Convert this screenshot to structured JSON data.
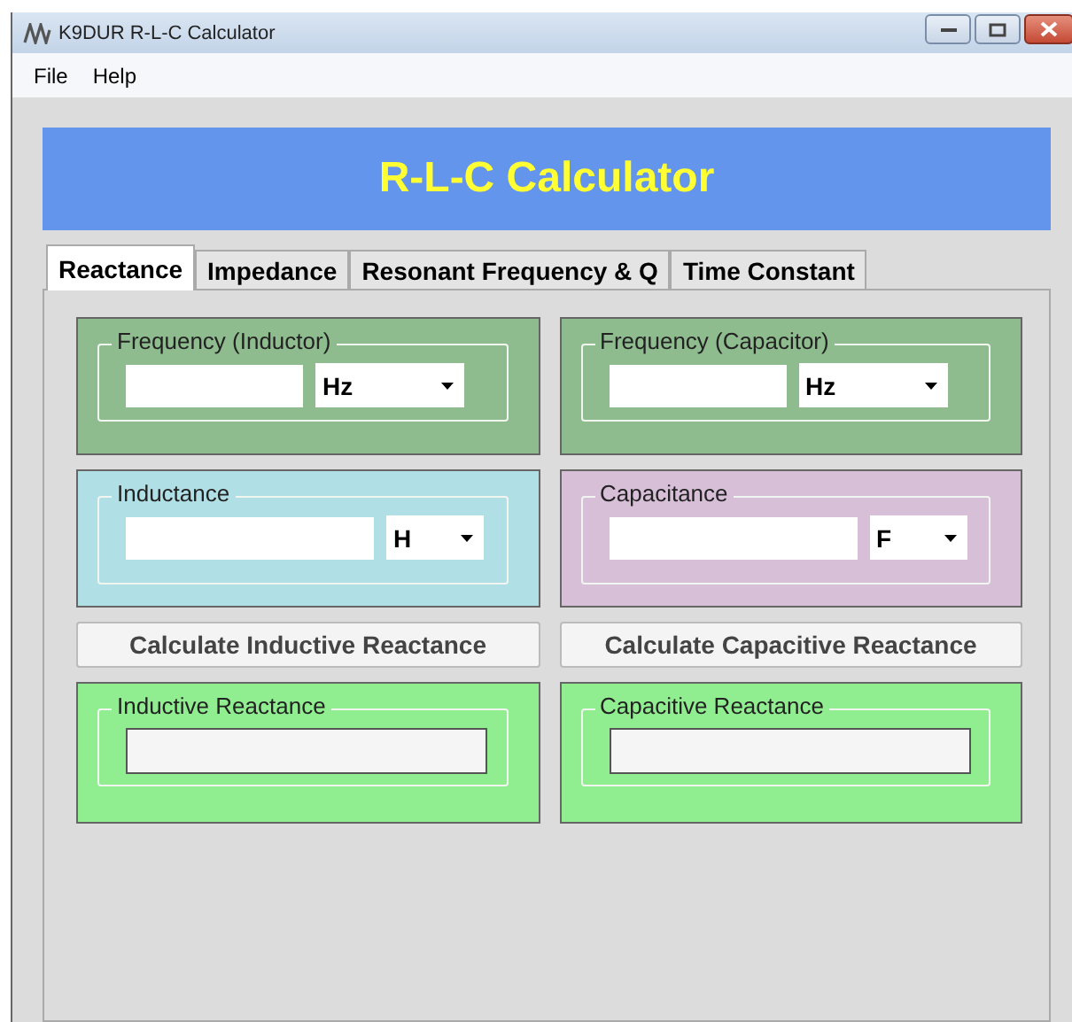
{
  "window": {
    "title": "K9DUR R-L-C Calculator"
  },
  "menu": [
    "File",
    "Help"
  ],
  "banner": {
    "title": "R-L-C Calculator"
  },
  "tabs": [
    {
      "label": "Reactance",
      "selected": true
    },
    {
      "label": "Impedance",
      "selected": false
    },
    {
      "label": "Resonant Frequency & Q",
      "selected": false
    },
    {
      "label": "Time Constant",
      "selected": false
    }
  ],
  "columns": [
    {
      "items": [
        {
          "kind": "input",
          "legend": "Frequency (Inductor)",
          "color": "#8fbc8f",
          "unit": "Hz",
          "wide_unit": true
        },
        {
          "kind": "input",
          "legend": "Inductance",
          "color": "#b0dfe6",
          "unit": "H",
          "wide_unit": false
        },
        {
          "kind": "button",
          "label": "Calculate Inductive Reactance"
        },
        {
          "kind": "output",
          "legend": "Inductive Reactance",
          "color": "#90ee90"
        }
      ]
    },
    {
      "items": [
        {
          "kind": "input",
          "legend": "Frequency (Capacitor)",
          "color": "#8fbc8f",
          "unit": "Hz",
          "wide_unit": true
        },
        {
          "kind": "input",
          "legend": "Capacitance",
          "color": "#d8bfd8",
          "unit": "F",
          "wide_unit": false
        },
        {
          "kind": "button",
          "label": "Calculate Capacitive Reactance"
        },
        {
          "kind": "output",
          "legend": "Capacitive Reactance",
          "color": "#90ee90"
        }
      ]
    }
  ]
}
